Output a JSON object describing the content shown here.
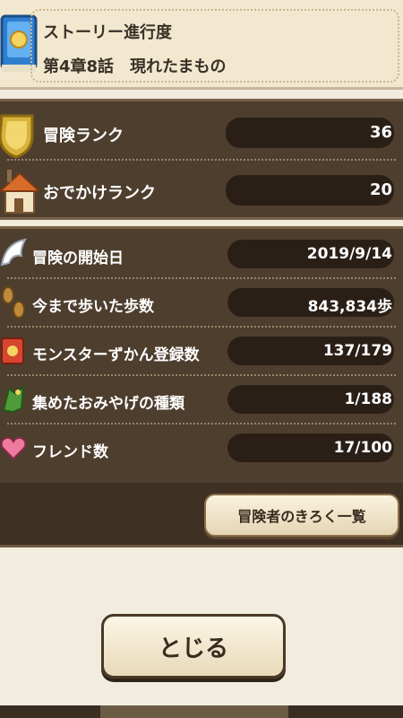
{
  "story": {
    "title": "ストーリー進行度",
    "chapter": "第4章8話　現れたまもの"
  },
  "ranks": [
    {
      "label": "冒険ランク",
      "value": "36",
      "icon": "shield-icon"
    },
    {
      "label": "おでかけランク",
      "value": "20",
      "icon": "house-icon"
    }
  ],
  "stats": [
    {
      "label": "冒険の開始日",
      "value": "2019/9/14",
      "icon": "wing-icon"
    },
    {
      "label": "今まで歩いた歩数",
      "value": "843,834歩",
      "icon": "footprints-icon"
    },
    {
      "label": "モンスターずかん登録数",
      "value": "137/179",
      "icon": "monster-book-icon"
    },
    {
      "label": "集めたおみやげの種類",
      "value": "1/188",
      "icon": "souvenir-map-icon"
    },
    {
      "label": "フレンド数",
      "value": "17/100",
      "icon": "friend-heart-icon"
    }
  ],
  "buttons": {
    "log": "冒険者のきろく一覧",
    "close": "とじる"
  }
}
